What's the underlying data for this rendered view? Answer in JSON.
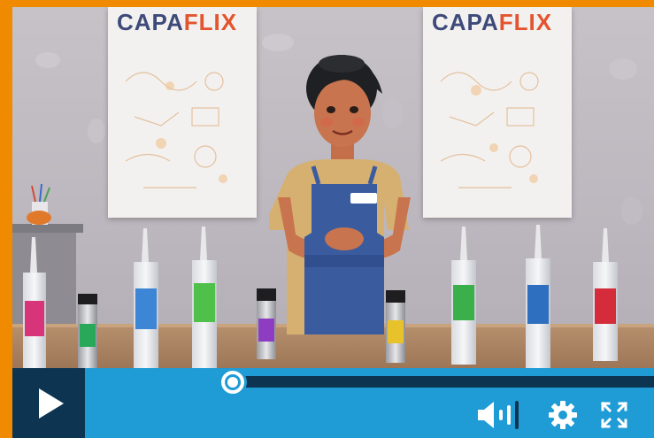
{
  "poster_left": {
    "logo_capa": "CAPA",
    "logo_flix": "FLIX"
  },
  "poster_right": {
    "logo_capa": "CAPA",
    "logo_flix": "FLIX"
  },
  "player": {
    "progress_fraction": 0.26,
    "play_icon": "play-icon",
    "volume_icon": "volume-icon",
    "settings_icon": "gear-icon",
    "fullscreen_icon": "fullscreen-icon"
  },
  "colors": {
    "frame": "#f08a00",
    "control_bar": "#1f9bd5",
    "control_dark": "#0d3551",
    "logo_blue": "#3d4a7a",
    "logo_orange": "#e2552f"
  }
}
